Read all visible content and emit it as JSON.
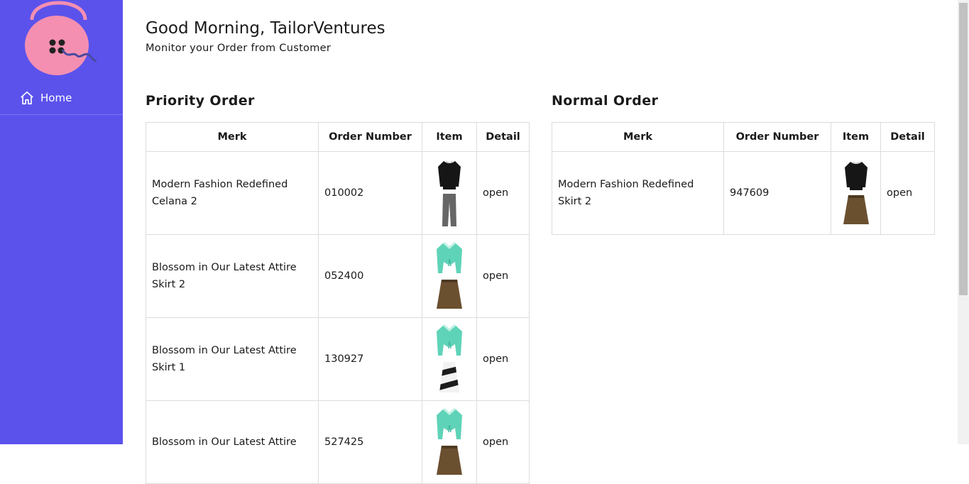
{
  "sidebar": {
    "logo_icon": "handbag-logo-icon",
    "nav": [
      {
        "label": "Home",
        "icon": "home-icon"
      }
    ],
    "background": "#5b52ec"
  },
  "header": {
    "greeting": "Good Morning, TailorVentures",
    "subtitle": "Monitor your Order from Customer"
  },
  "priority": {
    "title": "Priority Order",
    "columns": [
      "Merk",
      "Order Number",
      "Item",
      "Detail"
    ],
    "rows": [
      {
        "merk_line1": "Modern Fashion Redefined",
        "merk_line2": "Celana 2",
        "order_number": "010002",
        "items": [
          "black-top",
          "grey-trousers"
        ],
        "detail": "open"
      },
      {
        "merk_line1": "Blossom in Our Latest Attire",
        "merk_line2": "Skirt 2",
        "order_number": "052400",
        "items": [
          "teal-cardigan",
          "brown-skirt"
        ],
        "detail": "open"
      },
      {
        "merk_line1": "Blossom in Our Latest Attire",
        "merk_line2": "Skirt 1",
        "order_number": "130927",
        "items": [
          "teal-cardigan",
          "striped-skirt"
        ],
        "detail": "open"
      },
      {
        "merk_line1": "Blossom in Our Latest Attire",
        "merk_line2": "",
        "order_number": "527425",
        "items": [
          "teal-cardigan",
          "brown-skirt"
        ],
        "detail": "open"
      }
    ]
  },
  "normal": {
    "title": "Normal Order",
    "columns": [
      "Merk",
      "Order Number",
      "Item",
      "Detail"
    ],
    "rows": [
      {
        "merk_line1": "Modern Fashion Redefined",
        "merk_line2": "Skirt 2",
        "order_number": "947609",
        "items": [
          "black-top",
          "brown-skirt"
        ],
        "detail": "open"
      }
    ]
  }
}
